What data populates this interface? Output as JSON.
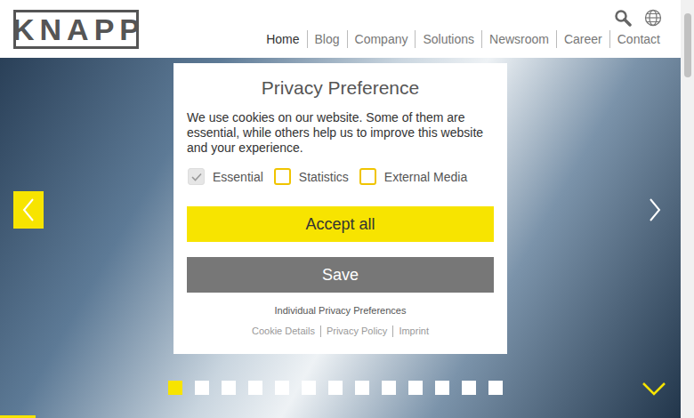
{
  "logo": {
    "text": "KNAPP"
  },
  "nav": [
    {
      "label": "Home",
      "selected": true
    },
    {
      "label": "Blog",
      "selected": false
    },
    {
      "label": "Company",
      "selected": false
    },
    {
      "label": "Solutions",
      "selected": false
    },
    {
      "label": "Newsroom",
      "selected": false
    },
    {
      "label": "Career",
      "selected": false
    },
    {
      "label": "Contact",
      "selected": false
    }
  ],
  "slider": {
    "dots": [
      {
        "selected": true
      },
      {
        "selected": false
      },
      {
        "selected": false
      },
      {
        "selected": false
      },
      {
        "selected": false
      },
      {
        "selected": false
      },
      {
        "selected": false
      },
      {
        "selected": false
      },
      {
        "selected": false
      },
      {
        "selected": false
      },
      {
        "selected": false
      },
      {
        "selected": false
      },
      {
        "selected": false
      }
    ]
  },
  "consent": {
    "title": "Privacy Preference",
    "text": "We use cookies on our website. Some of them are essential, while others help us to improve this website and your experience.",
    "options": [
      {
        "label": "Essential",
        "checked": true,
        "disabled": true
      },
      {
        "label": "Statistics",
        "checked": false,
        "disabled": false
      },
      {
        "label": "External Media",
        "checked": false,
        "disabled": false
      }
    ],
    "buttons": [
      "Accept all",
      "Save"
    ],
    "individual": "Individual Privacy Preferences",
    "links": [
      "Cookie Details",
      "Privacy Policy",
      "Imprint"
    ]
  }
}
